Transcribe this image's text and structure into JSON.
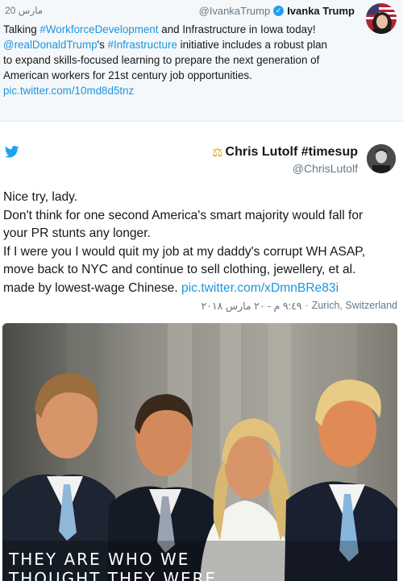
{
  "quoted_tweet": {
    "date": "20 مارس",
    "handle": "@IvankaTrump",
    "name": "Ivanka Trump",
    "verified_icon": "verified-check-icon",
    "text_lines": [
      [
        "Talking ",
        "#WorkforceDevelopment",
        " and Infrastructure in Iowa today!"
      ],
      [
        "@realDonaldTrump",
        "'s ",
        "#Infrastructure",
        " initiative includes a robust plan"
      ],
      [
        "to expand skills-focused learning to prepare the next generation of"
      ],
      [
        "American workers for 21st century job opportunities."
      ],
      [
        "pic.twitter.com/10md8d5tnz"
      ]
    ]
  },
  "tweet": {
    "platform_icon": "twitter-bird-icon",
    "name_emoji": "⚖",
    "name": "Chris Lutolf #timesup",
    "handle": "@ChrisLutolf",
    "lines": [
      "Nice try, lady.",
      "Don't think for one second America's smart majority would fall for",
      "your PR stunts any longer.",
      "If I were you I would quit my job at my daddy's corrupt WH ASAP,",
      "move back to NYC and continue to sell clothing, jewellery, et al."
    ],
    "last_line_text": "made by lowest-wage Chinese.",
    "last_line_link": "pic.twitter.com/xDmnBRe83i",
    "location": "Zurich, Switzerland",
    "separator": "·",
    "timestamp": "٩:٤٩ م - ٢٠ مارس ٢٠١٨"
  },
  "photo": {
    "caption_lines": [
      "THEY ARE WHO WE",
      "THOUGHT THEY WERE"
    ]
  },
  "colors": {
    "link": "#1b95e0",
    "twitter_blue": "#1da1f2",
    "muted": "#657786"
  }
}
